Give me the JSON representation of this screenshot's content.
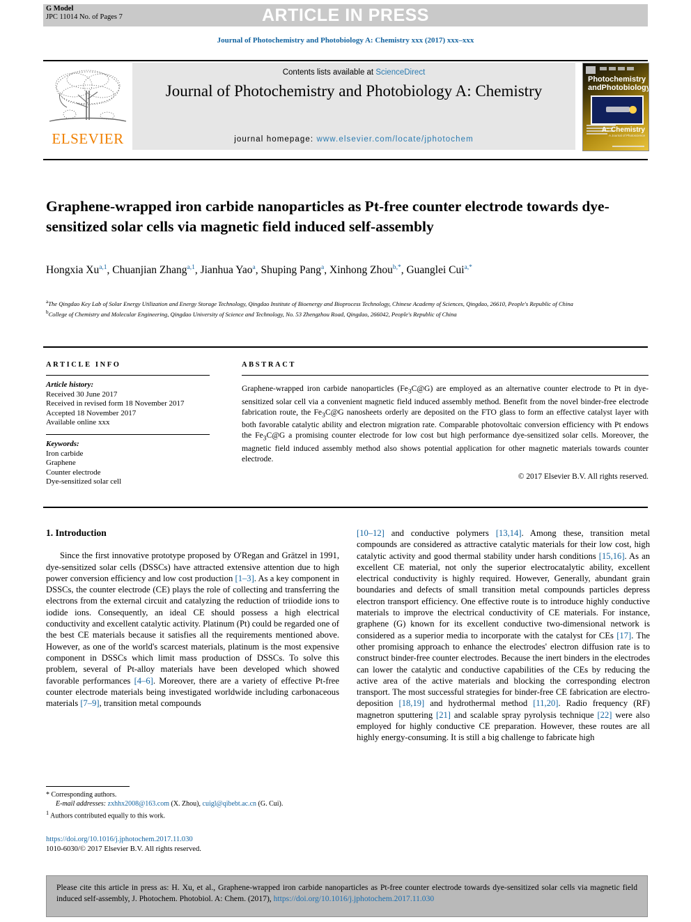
{
  "banner": {
    "press_text": "ARTICLE IN PRESS",
    "gmodel_line1": "G Model",
    "gmodel_line2": "JPC 11014 No. of Pages 7"
  },
  "journal_running_head": "Journal of Photochemistry and Photobiology A: Chemistry xxx (2017) xxx–xxx",
  "masthead": {
    "contents_prefix": "Contents lists available at ",
    "contents_link": "ScienceDirect",
    "title": "Journal of Photochemistry and Photobiology A: Chemistry",
    "homepage_prefix": "journal homepage: ",
    "homepage_url": "www.elsevier.com/locate/jphotochem",
    "publisher_logo_text": "ELSEVIER",
    "cover": {
      "title_line1": "Photochemistry",
      "title_line2": "andPhotobiology",
      "section": "A: Chemistry",
      "subtitle": "A Journal of Photoscience"
    }
  },
  "article": {
    "title": "Graphene-wrapped iron carbide nanoparticles as Pt-free counter electrode towards dye-sensitized solar cells via magnetic field induced self-assembly",
    "authors": [
      {
        "name": "Hongxia Xu",
        "marks": "a,1",
        "sep": ", "
      },
      {
        "name": "Chuanjian Zhang",
        "marks": "a,1",
        "sep": ", "
      },
      {
        "name": "Jianhua Yao",
        "marks": "a",
        "sep": ", "
      },
      {
        "name": "Shuping Pang",
        "marks": "a",
        "sep": ", "
      },
      {
        "name": "Xinhong Zhou",
        "marks": "b,*",
        "sep": ", "
      },
      {
        "name": "Guanglei Cui",
        "marks": "a,*",
        "sep": ""
      }
    ],
    "affiliations": [
      {
        "mark": "a",
        "text": "The Qingdao Key Lab of Solar Energy Utilization and Energy Storage Technology, Qingdao Institute of Bioenergy and Bioprocess Technology, Chinese Academy of Sciences, Qingdao, 26610, People's Republic of China"
      },
      {
        "mark": "b",
        "text": "College of Chemistry and Molecular Engineering, Qingdao University of Science and Technology, No. 53 Zhengzhou Road, Qingdao, 266042, People's Republic of China"
      }
    ]
  },
  "article_info": {
    "heading": "ARTICLE INFO",
    "history_label": "Article history:",
    "history": [
      "Received 30 June 2017",
      "Received in revised form 18 November 2017",
      "Accepted 18 November 2017",
      "Available online xxx"
    ],
    "keywords_label": "Keywords:",
    "keywords": [
      "Iron carbide",
      "Graphene",
      "Counter electrode",
      "Dye-sensitized solar cell"
    ]
  },
  "abstract": {
    "heading": "ABSTRACT",
    "text": "Graphene-wrapped iron carbide nanoparticles (Fe3C@G) are employed as an alternative counter electrode to Pt in dye-sensitized solar cell via a convenient magnetic field induced assembly method. Benefit from the novel binder-free electrode fabrication route, the Fe3C@G nanosheets orderly are deposited on the FTO glass to form an effective catalyst layer with both favorable catalytic ability and electron migration rate. Comparable photovoltaic conversion efficiency with Pt endows the Fe3C@G a promising counter electrode for low cost but high performance dye-sensitized solar cells. Moreover, the magnetic field induced assembly method also shows potential application for other magnetic materials towards counter electrode.",
    "copyright": "© 2017 Elsevier B.V. All rights reserved."
  },
  "body": {
    "section_heading": "1. Introduction",
    "left_paragraph": "Since the first innovative prototype proposed by O'Regan and Grätzel in 1991, dye-sensitized solar cells (DSSCs) have attracted extensive attention due to high power conversion efficiency and low cost production [1–3]. As a key component in DSSCs, the counter electrode (CE) plays the role of collecting and transferring the electrons from the external circuit and catalyzing the reduction of triiodide ions to iodide ions. Consequently, an ideal CE should possess a high electrical conductivity and excellent catalytic activity. Platinum (Pt) could be regarded one of the best CE materials because it satisfies all the requirements mentioned above. However, as one of the world's scarcest materials, platinum is the most expensive component in DSSCs which limit mass production of DSSCs. To solve this problem, several of Pt-alloy materials have been developed which showed favorable performances [4–6]. Moreover, there are a variety of effective Pt-free counter electrode materials being investigated worldwide including carbonaceous materials [7–9], transition metal compounds",
    "right_paragraph": "[10–12] and conductive polymers [13,14]. Among these, transition metal compounds are considered as attractive catalytic materials for their low cost, high catalytic activity and good thermal stability under harsh conditions [15,16]. As an excellent CE material, not only the superior electrocatalytic ability, excellent electrical conductivity is highly required. However, Generally, abundant grain boundaries and defects of small transition metal compounds particles depress electron transport efficiency. One effective route is to introduce highly conductive materials to improve the electrical conductivity of CE materials. For instance, graphene (G) known for its excellent conductive two-dimensional network is considered as a superior media to incorporate with the catalyst for CEs [17]. The other promising approach to enhance the electrodes' electron diffusion rate is to construct binder-free counter electrodes. Because the inert binders in the electrodes can lower the catalytic and conductive capabilities of the CEs by reducing the active area of the active materials and blocking the corresponding electron transport. The most successful strategies for binder-free CE fabrication are electro-deposition [18,19] and hydrothermal method [11,20]. Radio frequency (RF) magnetron sputtering [21] and scalable spray pyrolysis technique [22] were also employed for highly conductive CE preparation. However, these routes are all highly energy-consuming. It is still a big challenge to fabricate high"
  },
  "footnotes": {
    "corresponding": "Corresponding authors.",
    "email_label": "E-mail addresses:",
    "email1": "zxhhx2008@163.com",
    "email1_who": "(X. Zhou)",
    "email2": "cuigl@qibebt.ac.cn",
    "email2_who": "(G. Cui).",
    "equal_contrib": "Authors contributed equally to this work.",
    "doi": "https://doi.org/10.1016/j.jphotochem.2017.11.030",
    "issn_line": "1010-6030/© 2017 Elsevier B.V. All rights reserved."
  },
  "cite_box": {
    "text_before_link": "Please cite this article in press as: H. Xu, et al., Graphene-wrapped iron carbide nanoparticles as Pt-free counter electrode towards dye-sensitized solar cells via magnetic field induced self-assembly, J. Photochem. Photobiol. A: Chem. (2017), ",
    "link": "https://doi.org/10.1016/j.jphotochem.2017.11.030"
  },
  "colors": {
    "link_blue": "#1464a0",
    "masthead_gray": "#e6e6e6",
    "banner_gray": "#c9c9c9",
    "cite_gray": "#b9b9b9",
    "elsevier_orange": "#f08000"
  }
}
